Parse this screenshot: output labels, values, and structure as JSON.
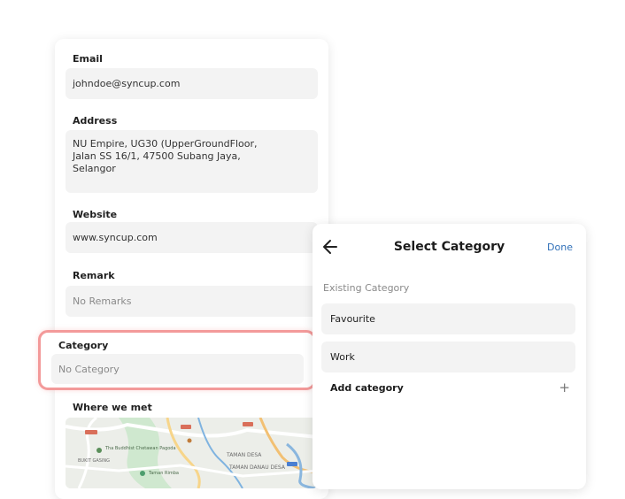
{
  "form": {
    "email": {
      "label": "Email",
      "value": "johndoe@syncup.com"
    },
    "address": {
      "label": "Address",
      "value": "NU Empire, UG30 (UpperGroundFloor,\nJalan SS 16/1, 47500 Subang Jaya,\nSelangor"
    },
    "website": {
      "label": "Website",
      "value": "www.syncup.com"
    },
    "remark": {
      "label": "Remark",
      "value": "No Remarks"
    },
    "category": {
      "label": "Category",
      "value": "No Category"
    },
    "where_met": {
      "label": "Where we met"
    }
  },
  "map": {
    "labels": [
      "Tha Buddhist Chetawan Pagoda",
      "BUKIT GASING",
      "TAMAN DESA",
      "TAMAN DANAU DESA",
      "Taman Rimba"
    ]
  },
  "category_panel": {
    "title": "Select Category",
    "done_label": "Done",
    "section_label": "Existing Category",
    "items": [
      "Favourite",
      "Work"
    ],
    "add_label": "Add category",
    "add_icon": "+"
  },
  "colors": {
    "highlight_border": "#f39a9a",
    "accent_link": "#2f6fb8",
    "field_bg": "#f3f3f3"
  }
}
